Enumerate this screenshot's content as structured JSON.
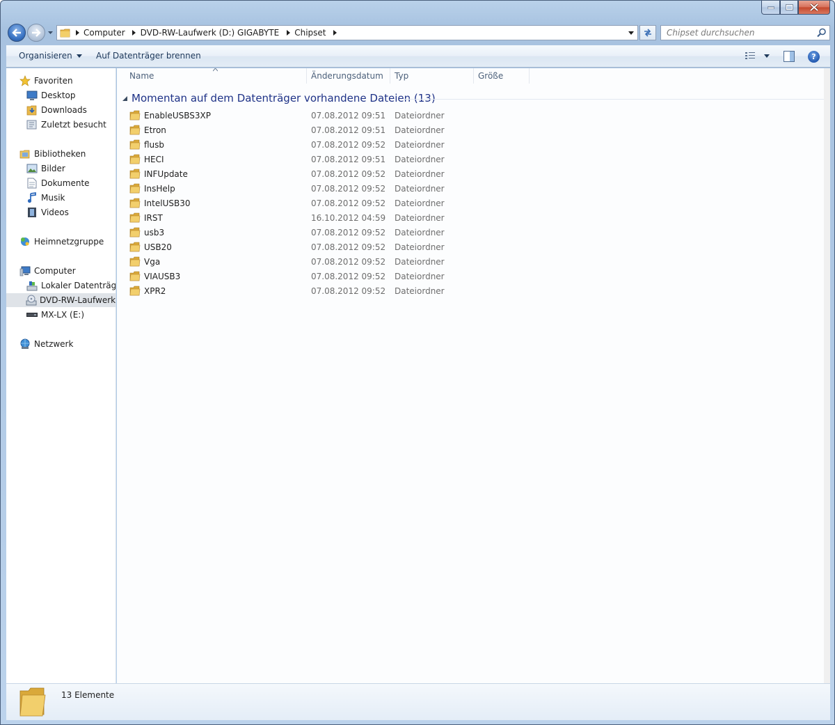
{
  "address": {
    "crumbs": [
      "Computer",
      "DVD-RW-Laufwerk (D:) GIGABYTE",
      "Chipset"
    ]
  },
  "search": {
    "placeholder": "Chipset durchsuchen"
  },
  "toolbar": {
    "organize_label": "Organisieren",
    "burn_label": "Auf Datenträger brennen",
    "help_label": "?"
  },
  "sidebar": {
    "favorites": {
      "label": "Favoriten",
      "items": [
        "Desktop",
        "Downloads",
        "Zuletzt besucht"
      ]
    },
    "libraries": {
      "label": "Bibliotheken",
      "items": [
        "Bilder",
        "Dokumente",
        "Musik",
        "Videos"
      ]
    },
    "homegroup": {
      "label": "Heimnetzgruppe"
    },
    "computer": {
      "label": "Computer",
      "items": [
        "Lokaler Datenträger",
        "DVD-RW-Laufwerk (",
        "MX-LX  (E:)"
      ]
    },
    "network": {
      "label": "Netzwerk"
    }
  },
  "columns": {
    "name": "Name",
    "date": "Änderungsdatum",
    "type": "Typ",
    "size": "Größe"
  },
  "group": {
    "title": "Momentan auf dem Datenträger vorhandene Dateien (13)"
  },
  "files": [
    {
      "name": "EnableUSBS3XP",
      "date": "07.08.2012 09:51",
      "type": "Dateiordner"
    },
    {
      "name": "Etron",
      "date": "07.08.2012 09:51",
      "type": "Dateiordner"
    },
    {
      "name": "flusb",
      "date": "07.08.2012 09:52",
      "type": "Dateiordner"
    },
    {
      "name": "HECI",
      "date": "07.08.2012 09:51",
      "type": "Dateiordner"
    },
    {
      "name": "INFUpdate",
      "date": "07.08.2012 09:52",
      "type": "Dateiordner"
    },
    {
      "name": "InsHelp",
      "date": "07.08.2012 09:52",
      "type": "Dateiordner"
    },
    {
      "name": "IntelUSB30",
      "date": "07.08.2012 09:52",
      "type": "Dateiordner"
    },
    {
      "name": "IRST",
      "date": "16.10.2012 04:59",
      "type": "Dateiordner"
    },
    {
      "name": "usb3",
      "date": "07.08.2012 09:52",
      "type": "Dateiordner"
    },
    {
      "name": "USB20",
      "date": "07.08.2012 09:52",
      "type": "Dateiordner"
    },
    {
      "name": "Vga",
      "date": "07.08.2012 09:52",
      "type": "Dateiordner"
    },
    {
      "name": "VIAUSB3",
      "date": "07.08.2012 09:52",
      "type": "Dateiordner"
    },
    {
      "name": "XPR2",
      "date": "07.08.2012 09:52",
      "type": "Dateiordner"
    }
  ],
  "details": {
    "count_text": "13 Elemente"
  },
  "colors": {
    "group_title": "#1e3287",
    "link": "#1e395b",
    "secondary_text": "#6d6d6d",
    "selection": "#dfe3e8"
  }
}
